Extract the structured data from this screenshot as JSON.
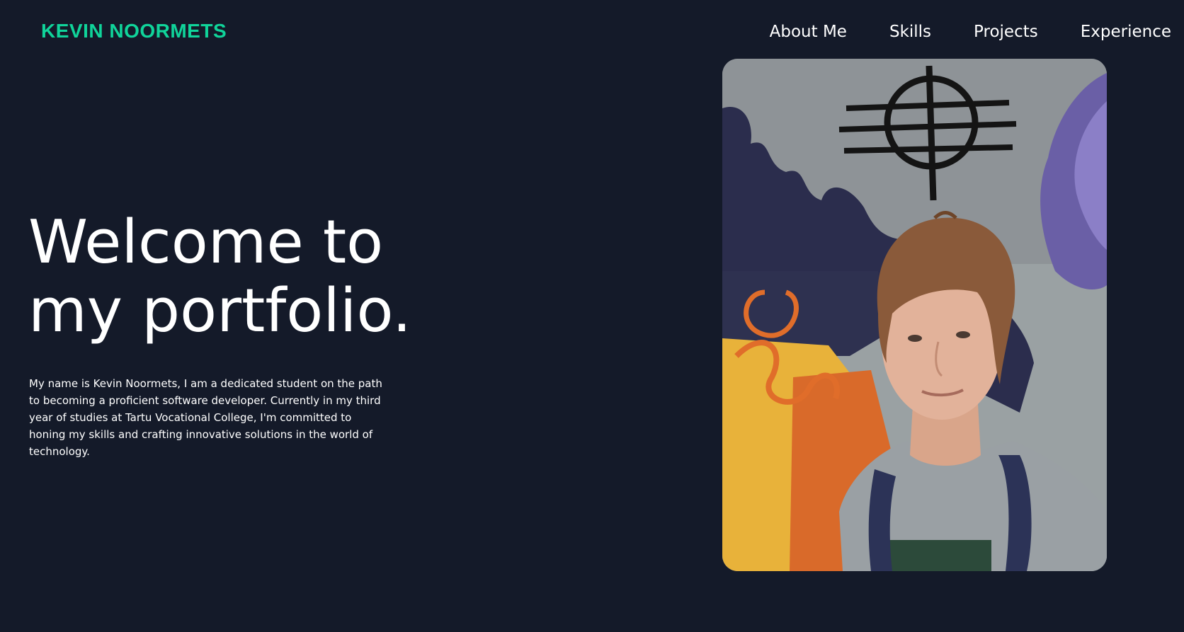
{
  "header": {
    "logo": "KEVIN NOORMETS",
    "nav": [
      {
        "label": "About Me"
      },
      {
        "label": "Skills"
      },
      {
        "label": "Projects"
      },
      {
        "label": "Experience"
      }
    ]
  },
  "hero": {
    "title_line1": "Welcome to",
    "title_line2": "my portfolio.",
    "intro": "My name is Kevin Noormets, I am a dedicated student on the path to becoming a proficient software developer. Currently in my third year of studies at Tartu Vocational College, I'm committed to honing my skills and crafting innovative solutions in the world of technology."
  },
  "colors": {
    "background": "#141a29",
    "accent": "#10d49a",
    "text": "#ffffff"
  }
}
